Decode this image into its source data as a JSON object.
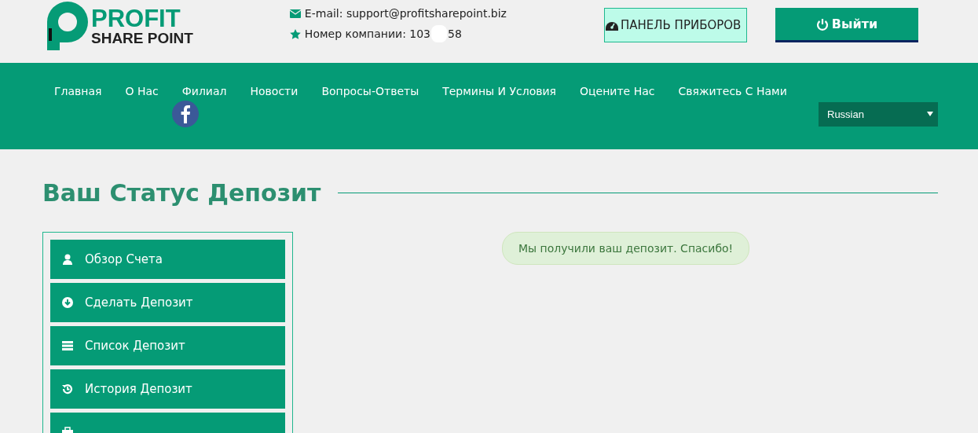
{
  "logo": {
    "line_1": "PROFIT",
    "line_2": "SHARE POINT"
  },
  "contacts": {
    "email": "E-mail: support@profitsharepoint.biz",
    "phone_start": "Номер компании: 103",
    "phone_end": "58"
  },
  "header_buttons": [
    {
      "label": "ПАНЕЛЬ ПРИБОРОВ",
      "kind": "dashboard"
    },
    {
      "label": "Выйти",
      "kind": "logout"
    }
  ],
  "nav": {
    "items": [
      "Главная",
      "О Нас",
      "Филиал",
      "Новости",
      "Вопросы-Ответы",
      "Термины И Условия",
      "Оцените Нас",
      "Свяжитесь С Нами"
    ],
    "language": "Russian"
  },
  "page_title": "Ваш Статус Депозит",
  "sidebar": {
    "items": [
      {
        "label": "Обзор Счета",
        "kind": "user"
      },
      {
        "label": "Сделать Депозит",
        "kind": "download"
      },
      {
        "label": "Список Депозит",
        "kind": "list"
      },
      {
        "label": "История Депозит",
        "kind": "history"
      },
      {
        "kind": "briefcase"
      }
    ]
  },
  "alert": "Мы получили ваш депозит. Спасибо!"
}
